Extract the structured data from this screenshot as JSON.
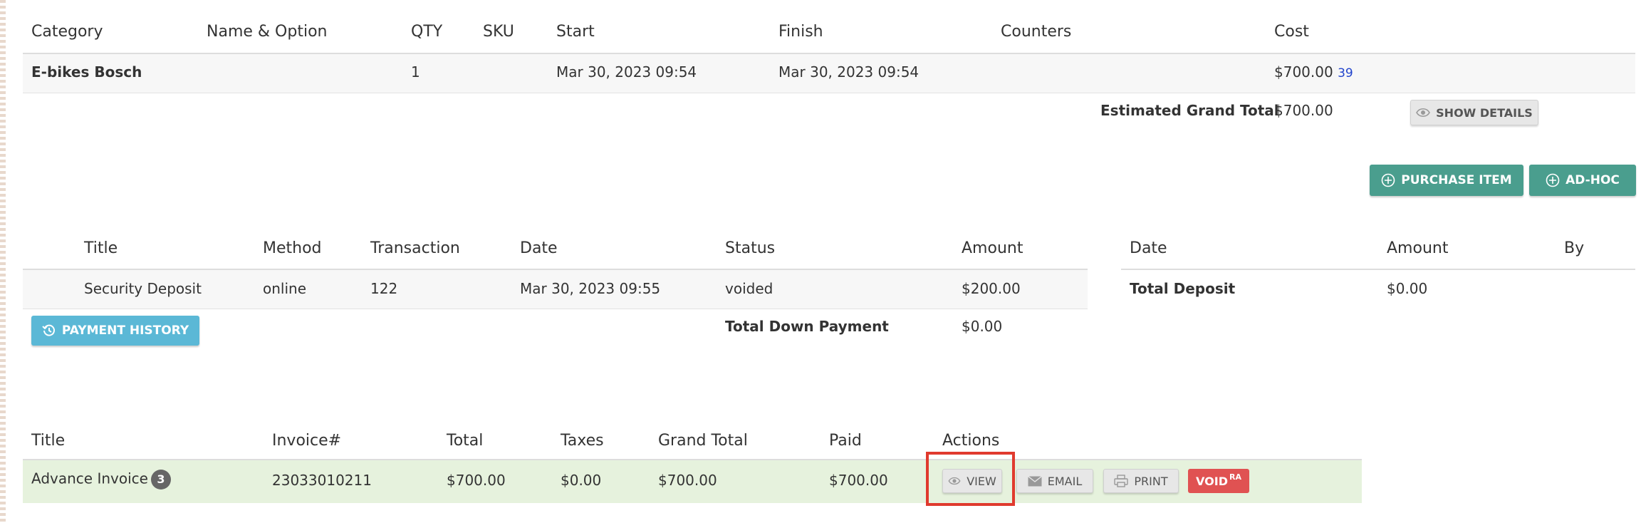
{
  "items": {
    "headers": [
      "Category",
      "Name & Option",
      "QTY",
      "SKU",
      "Start",
      "Finish",
      "Counters",
      "Cost"
    ],
    "row": {
      "category": "E-bikes Bosch",
      "name_option": "",
      "qty": "1",
      "sku": "",
      "start": "Mar 30, 2023 09:54",
      "finish": "Mar 30, 2023 09:54",
      "counters": "",
      "cost": "$700.00",
      "cost_link": "39"
    },
    "grand_total_label": "Estimated Grand Total",
    "grand_total_value": "$700.00",
    "show_details_label": "SHOW DETAILS",
    "purchase_item_label": "PURCHASE ITEM",
    "ad_hoc_label": "AD-HOC"
  },
  "payments": {
    "headers": [
      "Title",
      "Method",
      "Transaction",
      "Date",
      "Status",
      "Amount"
    ],
    "row": {
      "title": "Security Deposit",
      "method": "online",
      "transaction": "122",
      "date": "Mar 30, 2023 09:55",
      "status": "voided",
      "amount": "$200.00"
    },
    "payment_history_label": "PAYMENT HISTORY",
    "down_payment_label": "Total Down Payment",
    "down_payment_value": "$0.00"
  },
  "deposits": {
    "headers": [
      "Date",
      "Amount",
      "By"
    ],
    "total_label": "Total Deposit",
    "total_value": "$0.00"
  },
  "invoices": {
    "headers": [
      "Title",
      "Invoice#",
      "Total",
      "Taxes",
      "Grand Total",
      "Paid",
      "Actions"
    ],
    "row": {
      "title": "Advance Invoice",
      "badge": "3",
      "invoice": "23033010211",
      "total": "$700.00",
      "taxes": "$0.00",
      "grand_total": "$700.00",
      "paid": "$700.00"
    },
    "actions": {
      "view": "VIEW",
      "email": "EMAIL",
      "print": "PRINT",
      "void": "VOID",
      "void_sup": "RA"
    }
  },
  "colors": {
    "teal": "#4a9e8e",
    "blue": "#5bb8d6",
    "red": "#e05252",
    "highlight": "#e03a2e",
    "invoice_row": "#e6f2dd"
  }
}
